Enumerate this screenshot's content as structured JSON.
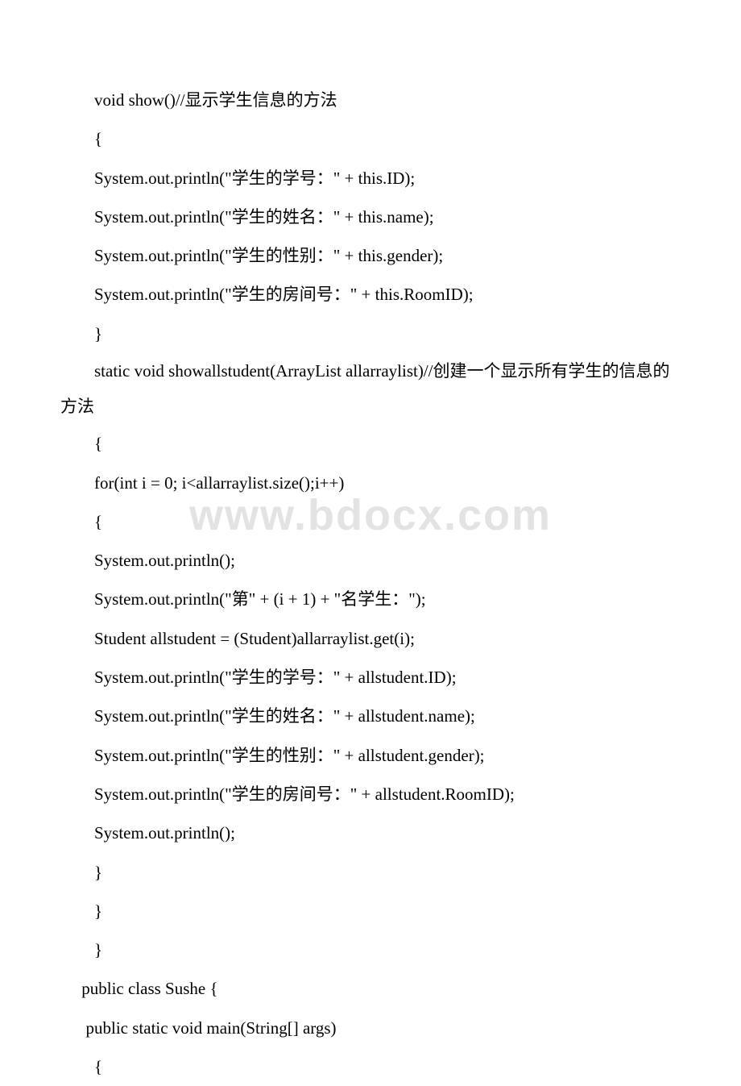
{
  "watermark": "www.bdocx.com",
  "lines": [
    "　　void show()//显示学生信息的方法",
    "　　{",
    "　　System.out.println(\"学生的学号：\" + this.ID);",
    "　　System.out.println(\"学生的姓名：\" + this.name);",
    "　　System.out.println(\"学生的性别：\" + this.gender);",
    "　　System.out.println(\"学生的房间号：\" + this.RoomID);",
    "　　}",
    "　　static void showallstudent(ArrayList allarraylist)//创建一个显示所有学生的信息的方法",
    "　　{",
    "　　for(int i = 0; i<allarraylist.size();i++)",
    "　　{",
    "　　System.out.println();",
    "　　System.out.println(\"第\" + (i + 1) + \"名学生：\");",
    "　　Student allstudent = (Student)allarraylist.get(i);",
    "　　System.out.println(\"学生的学号：\" + allstudent.ID);",
    "　　System.out.println(\"学生的姓名：\" + allstudent.name);",
    "　　System.out.println(\"学生的性别：\" + allstudent.gender);",
    "　　System.out.println(\"学生的房间号：\" + allstudent.RoomID);",
    "　　System.out.println();",
    "　　}",
    "　　}",
    "　　}",
    "　 public class Sushe {",
    "　  public static void main(String[] args)",
    "　　{"
  ]
}
